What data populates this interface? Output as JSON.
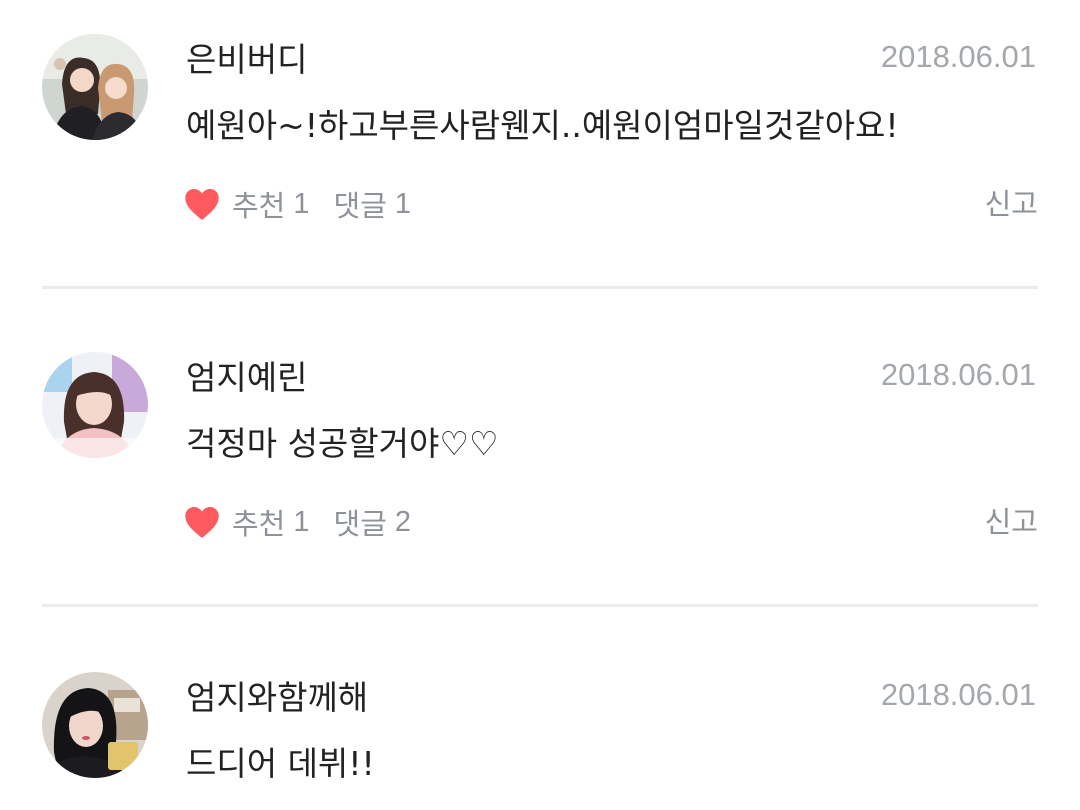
{
  "comments": [
    {
      "username": "은비버디",
      "date": "2018.06.01",
      "text": "예원아~!하고부른사람웬지..예원이엄마일것같아요!",
      "recommend_label": "추천",
      "recommend_count": "1",
      "reply_label": "댓글",
      "reply_count": "1",
      "report_label": "신고",
      "avatar_icon": "avatar-photo-two-women"
    },
    {
      "username": "엄지예린",
      "date": "2018.06.01",
      "text": "걱정마 성공할거야♡♡",
      "recommend_label": "추천",
      "recommend_count": "1",
      "reply_label": "댓글",
      "reply_count": "2",
      "report_label": "신고",
      "avatar_icon": "avatar-photo-girl-pink"
    },
    {
      "username": "엄지와함께해",
      "date": "2018.06.01",
      "text": "드디어 데뷔!!",
      "avatar_icon": "avatar-photo-girl-dark"
    }
  ],
  "colors": {
    "heart": "#ff5a5f",
    "date": "#a3a8ad",
    "meta": "#8e9399",
    "divider": "#ebebeb"
  }
}
